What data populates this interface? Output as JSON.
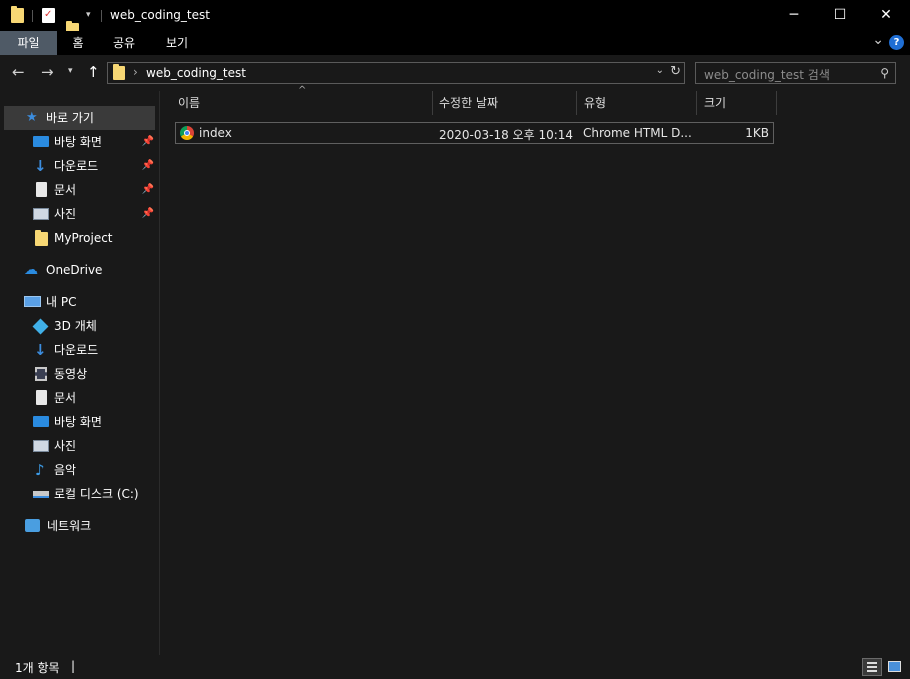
{
  "window": {
    "title": "web_coding_test",
    "controls": {
      "minimize": "─",
      "maximize": "☐",
      "close": "✕"
    }
  },
  "ribbon": {
    "tabs": [
      {
        "label": "파일",
        "active": true
      },
      {
        "label": "홈",
        "active": false
      },
      {
        "label": "공유",
        "active": false
      },
      {
        "label": "보기",
        "active": false
      }
    ],
    "collapse_glyph": "⌄",
    "help_glyph": "?"
  },
  "address": {
    "path": "web_coding_test",
    "chevron": "›",
    "search_placeholder": "web_coding_test 검색"
  },
  "nav": {
    "quick_access": "바로 가기",
    "quick_items": [
      {
        "label": "바탕 화면",
        "pinned": true
      },
      {
        "label": "다운로드",
        "pinned": true
      },
      {
        "label": "문서",
        "pinned": true
      },
      {
        "label": "사진",
        "pinned": true
      },
      {
        "label": "MyProject",
        "pinned": false
      }
    ],
    "onedrive": "OneDrive",
    "this_pc": "내 PC",
    "pc_items": [
      {
        "label": "3D 개체"
      },
      {
        "label": "다운로드"
      },
      {
        "label": "동영상"
      },
      {
        "label": "문서"
      },
      {
        "label": "바탕 화면"
      },
      {
        "label": "사진"
      },
      {
        "label": "음악"
      },
      {
        "label": "로컬 디스크 (C:)"
      }
    ],
    "network": "네트워크"
  },
  "columns": {
    "name": "이름",
    "modified": "수정한 날짜",
    "type": "유형",
    "size": "크기"
  },
  "files": [
    {
      "name": "index",
      "modified": "2020-03-18 오후 10:14",
      "type": "Chrome HTML D...",
      "size": "1KB"
    }
  ],
  "status": {
    "item_count": "1개 항목",
    "separator": "|"
  },
  "colors": {
    "accent_blue": "#1f6ed4",
    "folder_yellow": "#f7d774",
    "selected_tab": "#4f5a66"
  }
}
